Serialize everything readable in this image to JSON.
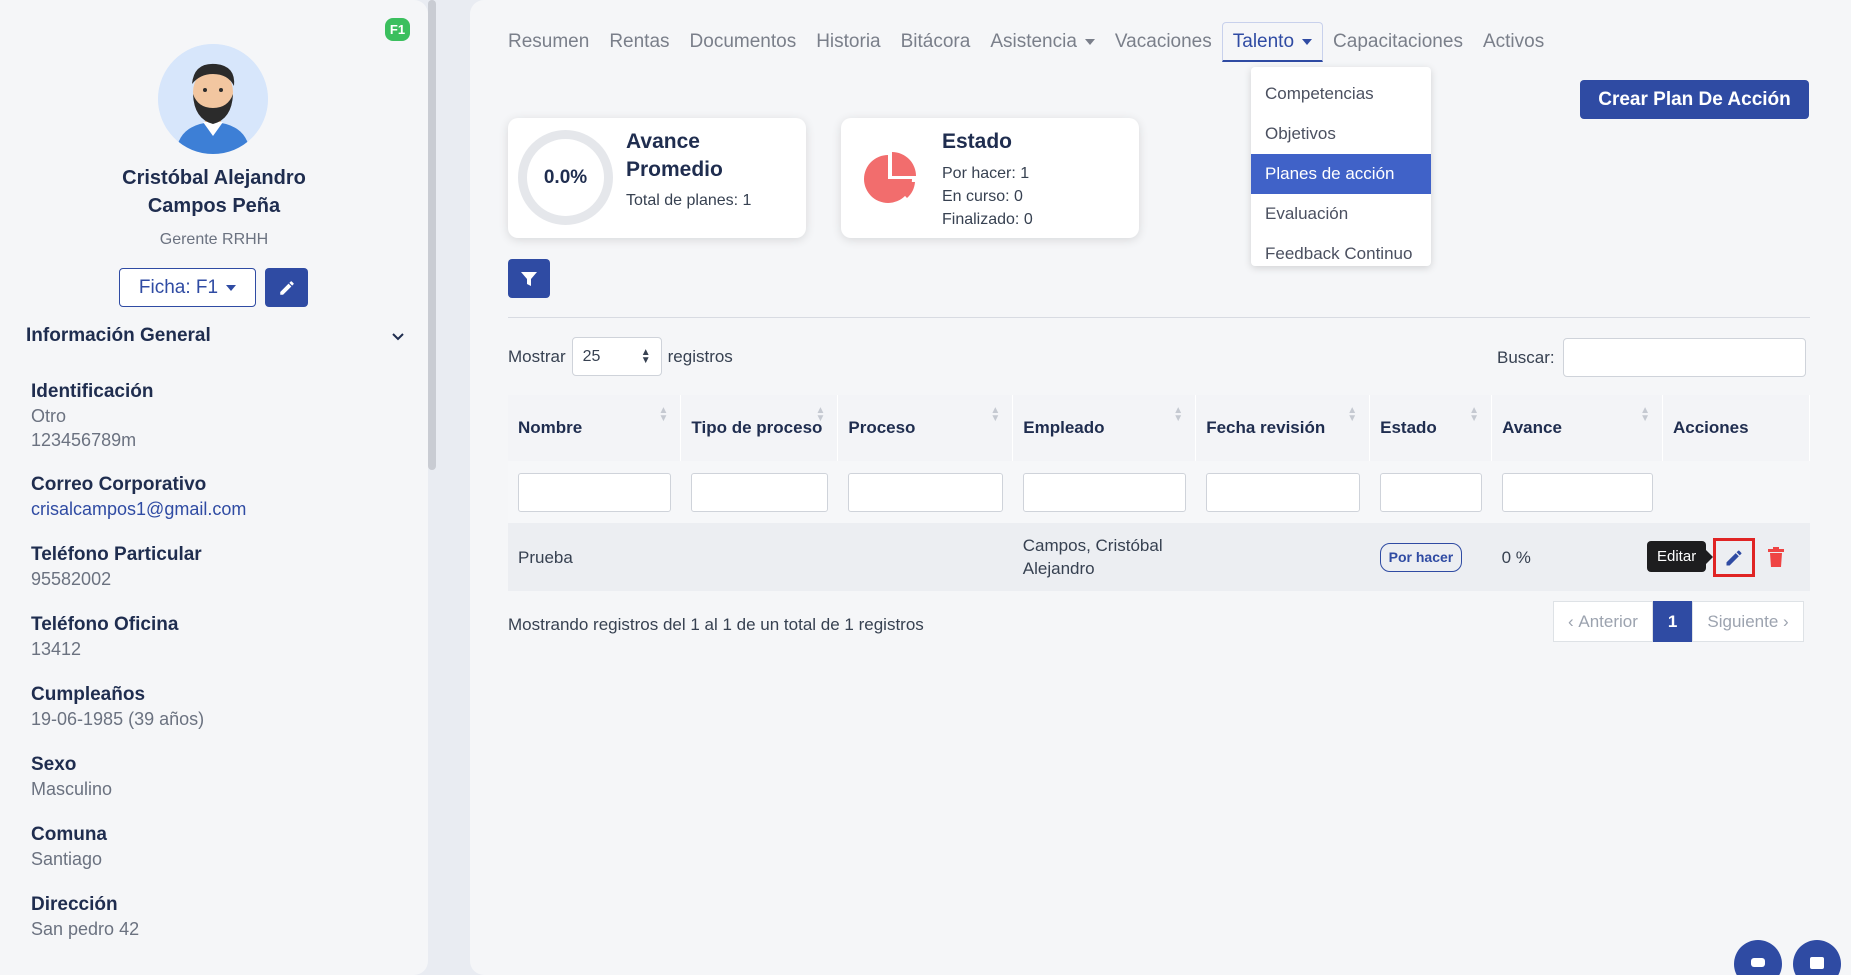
{
  "profile": {
    "badge": "F1",
    "name_line1": "Cristóbal Alejandro",
    "name_line2": "Campos Peña",
    "role": "Gerente RRHH",
    "ficha_label": "Ficha: F1"
  },
  "info": {
    "title": "Información General",
    "items": [
      {
        "label": "Identificación",
        "value1": "Otro",
        "value2": "123456789m"
      },
      {
        "label": "Correo Corporativo",
        "value1": "crisalcampos1@gmail.com"
      },
      {
        "label": "Teléfono Particular",
        "value1": "95582002"
      },
      {
        "label": "Teléfono Oficina",
        "value1": "13412"
      },
      {
        "label": "Cumpleaños",
        "value1": "19-06-1985 (39 años)"
      },
      {
        "label": "Sexo",
        "value1": "Masculino"
      },
      {
        "label": "Comuna",
        "value1": "Santiago"
      },
      {
        "label": "Dirección",
        "value1": "San pedro 42"
      }
    ]
  },
  "tabs": [
    "Resumen",
    "Rentas",
    "Documentos",
    "Historia",
    "Bitácora",
    "Asistencia",
    "Vacaciones",
    "Talento",
    "Capacitaciones",
    "Activos"
  ],
  "dropdown": [
    "Competencias",
    "Objetivos",
    "Planes de acción",
    "Evaluación",
    "Feedback Continuo"
  ],
  "create_button": "Crear Plan De Acción",
  "card_avance": {
    "value": "0.0%",
    "title": "Avance Promedio",
    "sub": "Total de planes: 1"
  },
  "card_estado": {
    "title": "Estado",
    "line1": "Por hacer: 1",
    "line2": "En curso: 0",
    "line3": "Finalizado: 0"
  },
  "show": {
    "prefix": "Mostrar",
    "value": "25",
    "suffix": "registros"
  },
  "search_label": "Buscar:",
  "table": {
    "headers": [
      "Nombre",
      "Tipo de proceso",
      "Proceso",
      "Empleado",
      "Fecha revisión",
      "Estado",
      "Avance",
      "Acciones"
    ],
    "row": {
      "nombre": "Prueba",
      "tipo": "",
      "proceso": "",
      "empleado": "Campos, Cristóbal Alejandro",
      "fecha": "",
      "estado": "Por hacer",
      "avance": "0 %"
    }
  },
  "tooltip": "Editar",
  "footer": "Mostrando registros del 1 al 1 de un total de 1 registros",
  "pager": {
    "prev": "Anterior",
    "page": "1",
    "next": "Siguiente"
  },
  "colors": {
    "primary": "#2f4ba3",
    "danger": "#e02424",
    "success": "#3bbf5e",
    "pie": "#f26d6d"
  }
}
